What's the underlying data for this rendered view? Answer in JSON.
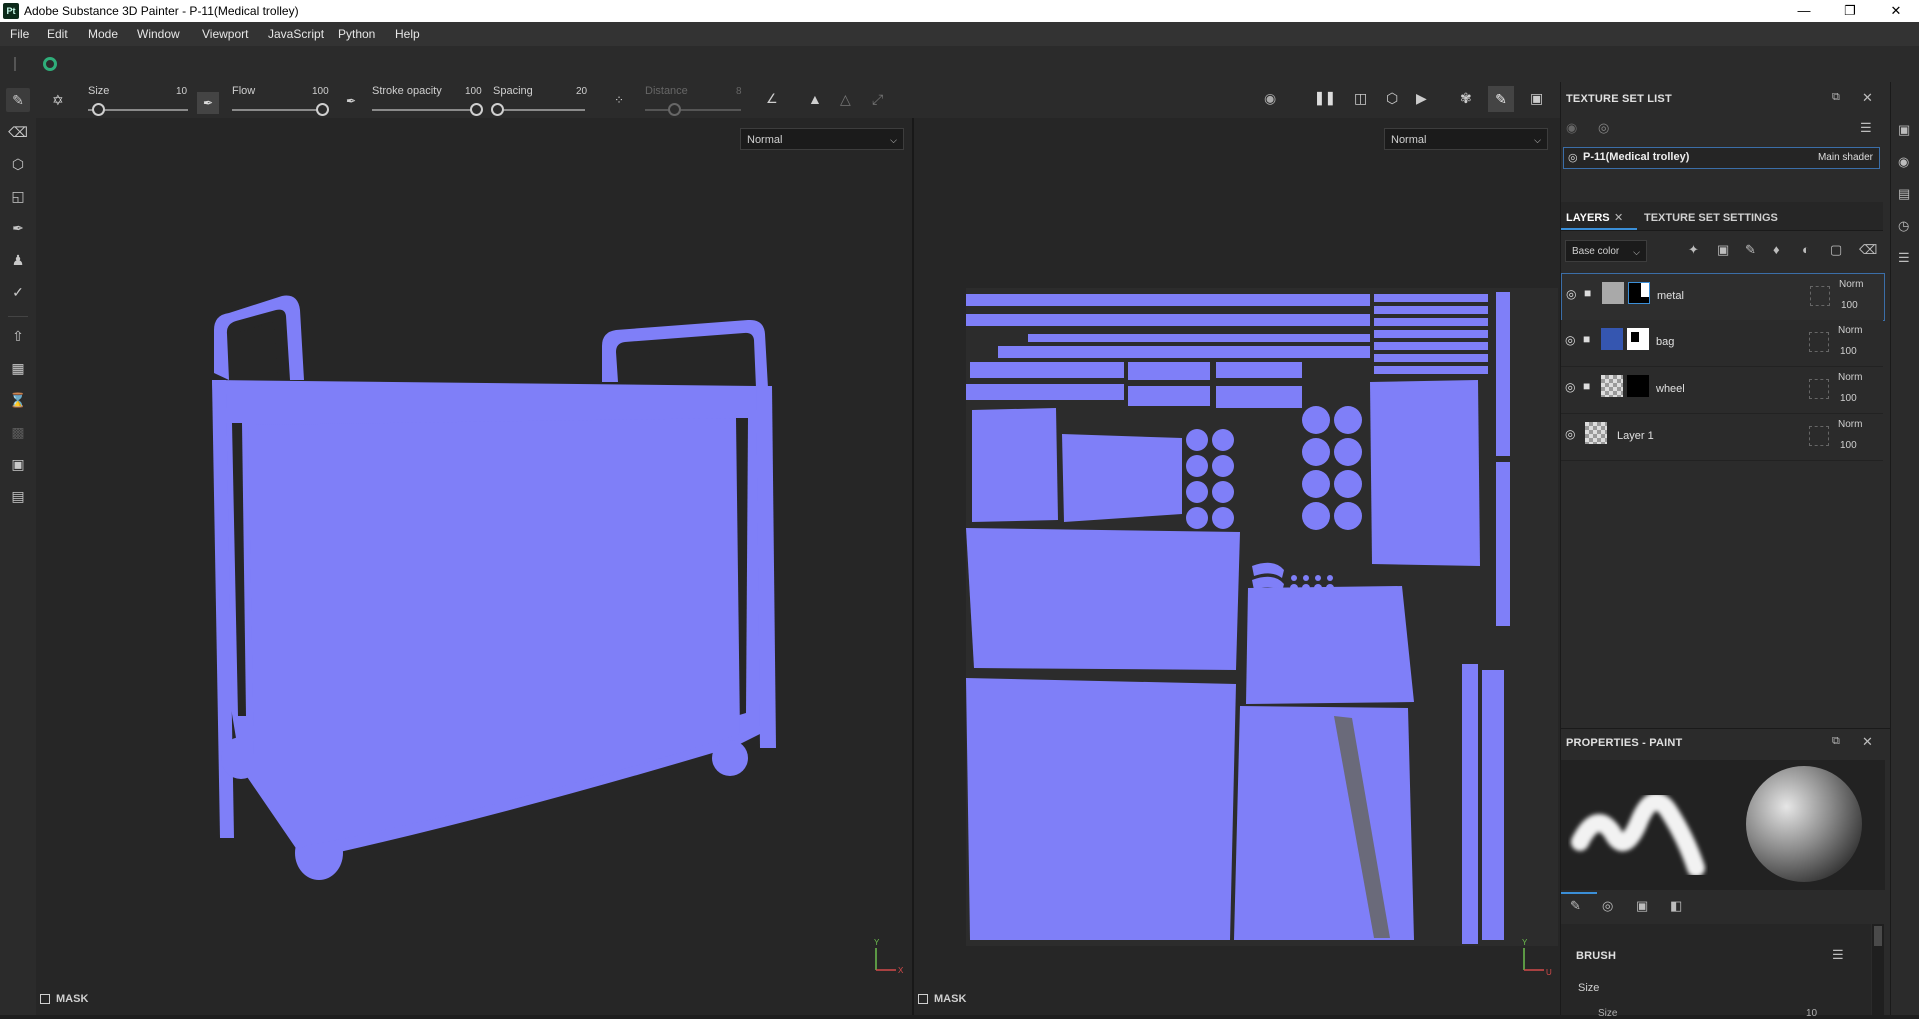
{
  "window": {
    "app_icon": "Pt",
    "title": "Adobe Substance 3D Painter - P-11(Medical trolley)",
    "minimize_icon": "minimize-icon",
    "maximize_icon": "restore-icon",
    "close_icon": "close-icon"
  },
  "menu": [
    "File",
    "Edit",
    "Mode",
    "Window",
    "Viewport",
    "JavaScript",
    "Python",
    "Help"
  ],
  "paint_bar": {
    "size": {
      "label": "Size",
      "value": "10",
      "fraction": 0.1
    },
    "flow": {
      "label": "Flow",
      "value": "100",
      "fraction": 1.0
    },
    "stroke_opacity": {
      "label": "Stroke opacity",
      "value": "100",
      "fraction": 1.0
    },
    "spacing": {
      "label": "Spacing",
      "value": "20",
      "fraction": 0.02
    },
    "distance": {
      "label": "Distance",
      "value": "8",
      "fraction": 0.3
    }
  },
  "viewport_3d": {
    "blend_mode": "Normal",
    "mask_label": "MASK",
    "axis_y": "Y",
    "axis_x": "X"
  },
  "viewport_2d": {
    "blend_mode": "Normal",
    "mask_label": "MASK",
    "axis_y": "Y",
    "axis_u": "U"
  },
  "texture_set_list": {
    "title": "TEXTURE SET LIST",
    "item_name": "P-11(Medical trolley)",
    "item_shader": "Main shader"
  },
  "layers_panel": {
    "tab_layers": "LAYERS",
    "tab_texture_settings": "TEXTURE SET SETTINGS",
    "channel": "Base color",
    "layers": [
      {
        "name": "metal",
        "blend": "Norm",
        "opacity": "100",
        "color": "#a9a9a9",
        "mask": "black-white",
        "selected": true,
        "folder": true
      },
      {
        "name": "bag",
        "blend": "Norm",
        "opacity": "100",
        "color": "#3556b0",
        "mask": "white-black",
        "selected": false,
        "folder": true
      },
      {
        "name": "wheel",
        "blend": "Norm",
        "opacity": "100",
        "color": "checker",
        "mask": "black",
        "selected": false,
        "folder": true
      },
      {
        "name": "Layer 1",
        "blend": "Norm",
        "opacity": "100",
        "color": "checker",
        "mask": "none",
        "selected": false,
        "folder": false
      }
    ]
  },
  "properties": {
    "title": "PROPERTIES - PAINT",
    "brush_section": "BRUSH",
    "size_label": "Size",
    "size_sub_label": "Size",
    "size_sub_value": "10"
  },
  "colors": {
    "uv_blue": "#7f7ff8",
    "selection": "#3b6ea8"
  }
}
